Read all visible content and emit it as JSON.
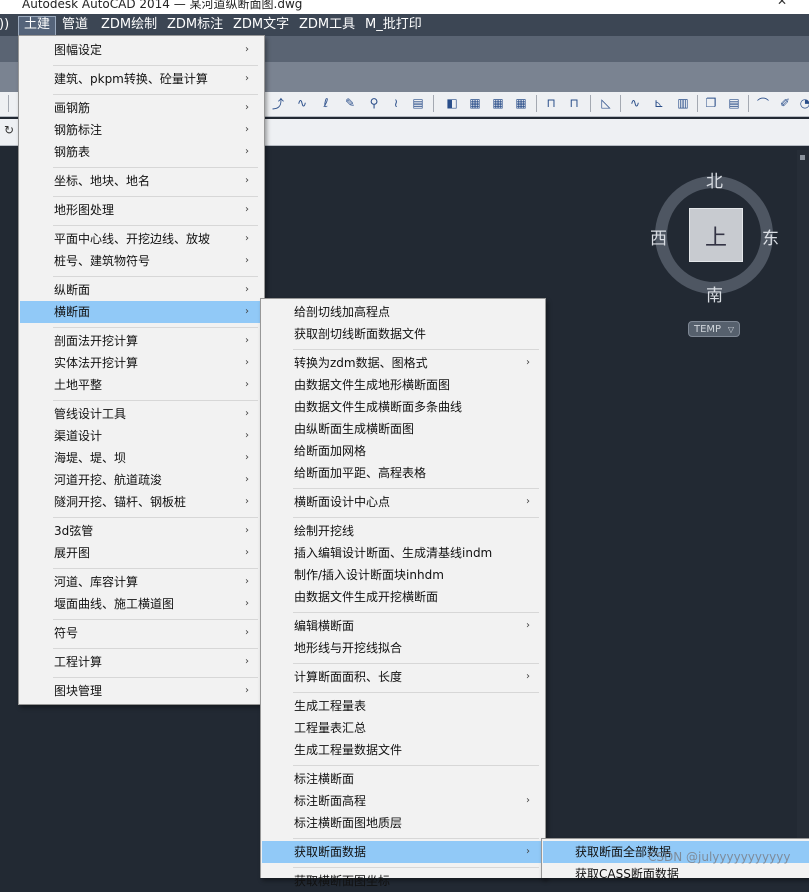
{
  "window": {
    "title": "Autodesk AutoCAD 2014 — 某河道纵断面图.dwg",
    "close": "✕"
  },
  "menubar": [
    "))",
    "土建",
    "管道",
    "ZDM绘制",
    "ZDM标注",
    "ZDM文字",
    "ZDM工具",
    "M_批打印"
  ],
  "main_menu": {
    "arrow": "›",
    "items": [
      "图幅设定",
      "建筑、pkpm转换、砼量计算",
      "画钢筋",
      "钢筋标注",
      "钢筋表",
      "坐标、地块、地名",
      "地形图处理",
      "平面中心线、开挖边线、放坡",
      "桩号、建筑物符号",
      "纵断面",
      "横断面",
      "剖面法开挖计算",
      "实体法开挖计算",
      "土地平整",
      "管线设计工具",
      "渠道设计",
      "海堤、堤、坝",
      "河道开挖、航道疏浚",
      "隧洞开挖、锚杆、钢板桩",
      "3d弦管",
      "展开图",
      "河道、库容计算",
      "堰面曲线、施工横道图",
      "符号",
      "工程计算",
      "图块管理"
    ]
  },
  "sub_menu": {
    "items": [
      "给剖切线加高程点",
      "获取剖切线断面数据文件",
      "转换为zdm数据、图格式",
      "由数据文件生成地形横断面图",
      "由数据文件生成横断面多条曲线",
      "由纵断面生成横断面图",
      "给断面加网格",
      "给断面加平距、高程表格",
      "横断面设计中心点",
      "绘制开挖线",
      "插入编辑设计断面、生成清基线indm",
      "制作/插入设计断面块inhdm",
      "由数据文件生成开挖横断面",
      "编辑横断面",
      "地形线与开挖线拟合",
      "计算断面面积、长度",
      "生成工程量表",
      "工程量表汇总",
      "生成工程量数据文件",
      "标注横断面",
      "标注断面高程",
      "标注横断面图地质层",
      "获取断面数据",
      "获取横断面图坐标"
    ]
  },
  "sub_sub_menu": {
    "items": [
      "获取断面全部数据",
      "获取CASS断面数据"
    ]
  },
  "viewcube": {
    "north": "北",
    "south": "南",
    "east": "东",
    "west": "西",
    "face": "上",
    "wcs": "TEMP",
    "wcs_arrow": "▽"
  },
  "watermark": "CSDN @julyyyyyyyyyyy",
  "colors": {
    "highlight": "#91c9f7",
    "canvas": "#222933",
    "menu_bg": "#f2f2f2"
  }
}
